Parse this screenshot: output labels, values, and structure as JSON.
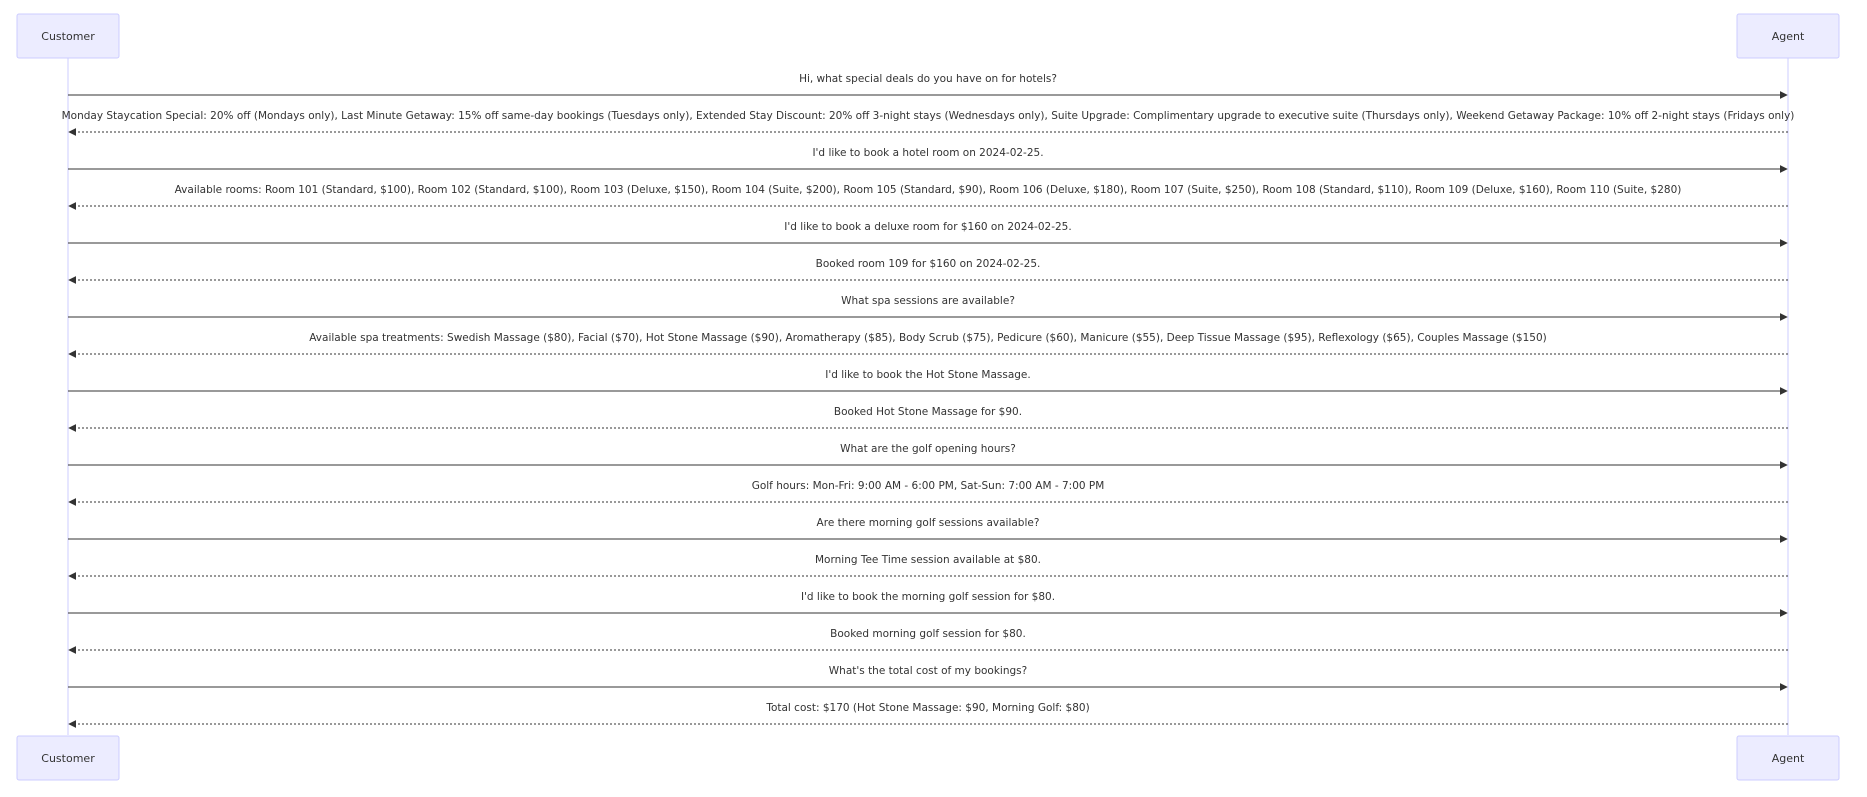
{
  "participants": [
    {
      "id": "customer",
      "label": "Customer"
    },
    {
      "id": "agent",
      "label": "Agent"
    }
  ],
  "messages": [
    {
      "from": "customer",
      "to": "agent",
      "style": "solid",
      "text": "Hi, what special deals do you have on for hotels?"
    },
    {
      "from": "agent",
      "to": "customer",
      "style": "dashed",
      "text": "Monday Staycation Special: 20% off (Mondays only), Last Minute Getaway: 15% off same-day bookings (Tuesdays only), Extended Stay Discount: 20% off 3-night stays (Wednesdays only), Suite Upgrade: Complimentary upgrade to executive suite (Thursdays only), Weekend Getaway Package: 10% off 2-night stays (Fridays only)"
    },
    {
      "from": "customer",
      "to": "agent",
      "style": "solid",
      "text": "I'd like to book a hotel room on 2024-02-25."
    },
    {
      "from": "agent",
      "to": "customer",
      "style": "dashed",
      "text": "Available rooms: Room 101 (Standard, $100), Room 102 (Standard, $100), Room 103 (Deluxe, $150), Room 104 (Suite, $200), Room 105 (Standard, $90), Room 106 (Deluxe, $180), Room 107 (Suite, $250), Room 108 (Standard, $110), Room 109 (Deluxe, $160), Room 110 (Suite, $280)"
    },
    {
      "from": "customer",
      "to": "agent",
      "style": "solid",
      "text": "I'd like to book a deluxe room for $160 on 2024-02-25."
    },
    {
      "from": "agent",
      "to": "customer",
      "style": "dashed",
      "text": "Booked room 109 for $160 on 2024-02-25."
    },
    {
      "from": "customer",
      "to": "agent",
      "style": "solid",
      "text": "What spa sessions are available?"
    },
    {
      "from": "agent",
      "to": "customer",
      "style": "dashed",
      "text": "Available spa treatments: Swedish Massage ($80), Facial ($70), Hot Stone Massage ($90), Aromatherapy ($85), Body Scrub ($75), Pedicure ($60), Manicure ($55), Deep Tissue Massage ($95), Reflexology ($65), Couples Massage ($150)"
    },
    {
      "from": "customer",
      "to": "agent",
      "style": "solid",
      "text": "I'd like to book the Hot Stone Massage."
    },
    {
      "from": "agent",
      "to": "customer",
      "style": "dashed",
      "text": "Booked Hot Stone Massage for $90."
    },
    {
      "from": "customer",
      "to": "agent",
      "style": "solid",
      "text": "What are the golf opening hours?"
    },
    {
      "from": "agent",
      "to": "customer",
      "style": "dashed",
      "text": "Golf hours: Mon-Fri: 9:00 AM - 6:00 PM, Sat-Sun: 7:00 AM - 7:00 PM"
    },
    {
      "from": "customer",
      "to": "agent",
      "style": "solid",
      "text": "Are there morning golf sessions available?"
    },
    {
      "from": "agent",
      "to": "customer",
      "style": "dashed",
      "text": "Morning Tee Time session available at $80."
    },
    {
      "from": "customer",
      "to": "agent",
      "style": "solid",
      "text": "I'd like to book the morning golf session for $80."
    },
    {
      "from": "agent",
      "to": "customer",
      "style": "dashed",
      "text": "Booked morning golf session for $80."
    },
    {
      "from": "customer",
      "to": "agent",
      "style": "solid",
      "text": "What's the total cost of my bookings?"
    },
    {
      "from": "agent",
      "to": "customer",
      "style": "dashed",
      "text": "Total cost: $170 (Hot Stone Massage: $90, Morning Golf: $80)"
    }
  ]
}
